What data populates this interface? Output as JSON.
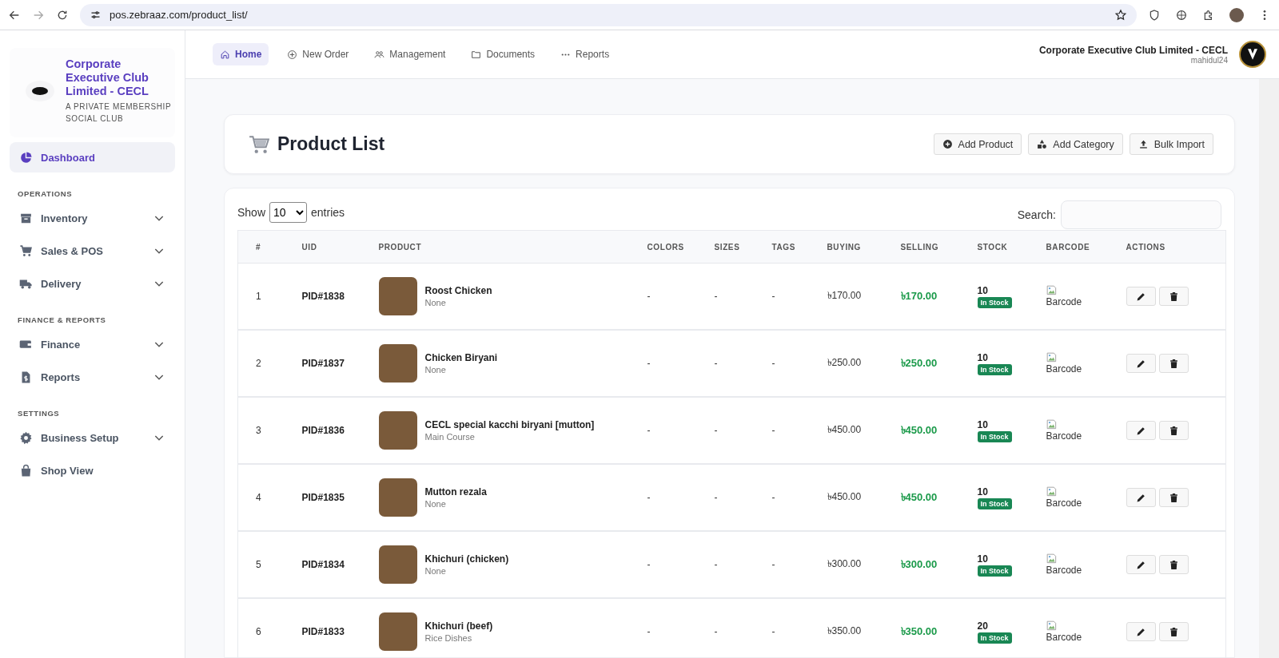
{
  "browser": {
    "url": "pos.zebraaz.com/product_list/"
  },
  "sidebar": {
    "brand": {
      "name": "Corporate Executive Club Limited - CECL",
      "tagline": "A PRIVATE MEMBERSHIP SOCIAL CLUB"
    },
    "groups": [
      {
        "items": [
          {
            "label": "Dashboard",
            "selected": true,
            "expandable": false
          }
        ]
      },
      {
        "heading": "OPERATIONS",
        "items": [
          {
            "label": "Inventory",
            "selected": false,
            "expandable": true
          },
          {
            "label": "Sales & POS",
            "selected": false,
            "expandable": true
          },
          {
            "label": "Delivery",
            "selected": false,
            "expandable": true
          }
        ]
      },
      {
        "heading": "FINANCE & REPORTS",
        "items": [
          {
            "label": "Finance",
            "selected": false,
            "expandable": true
          },
          {
            "label": "Reports",
            "selected": false,
            "expandable": true
          }
        ]
      },
      {
        "heading": "SETTINGS",
        "items": [
          {
            "label": "Business Setup",
            "selected": false,
            "expandable": true
          },
          {
            "label": "Shop View",
            "selected": false,
            "expandable": false
          }
        ]
      }
    ]
  },
  "topnav": {
    "tabs": [
      {
        "label": "Home",
        "selected": true
      },
      {
        "label": "New Order",
        "selected": false
      },
      {
        "label": "Management",
        "selected": false
      },
      {
        "label": "Documents",
        "selected": false
      },
      {
        "label": "Reports",
        "selected": false
      }
    ],
    "user": {
      "organization": "Corporate Executive Club Limited - CECL",
      "username": "mahidul24"
    }
  },
  "page": {
    "title": "Product List",
    "buttons": [
      "Add Product",
      "Add Category",
      "Bulk Import"
    ]
  },
  "table": {
    "show_label": "Show",
    "page_size": "10",
    "entries_label": "entries",
    "search_label": "Search:",
    "columns": [
      "#",
      "UID",
      "PRODUCT",
      "COLORS",
      "SIZES",
      "TAGS",
      "BUYING",
      "SELLING",
      "STOCK",
      "BARCODE",
      "ACTIONS"
    ],
    "rows": [
      {
        "index": "1",
        "uid": "PID#1838",
        "product": "Roost Chicken",
        "category": "None",
        "colors": "-",
        "sizes": "-",
        "tags": "-",
        "buying": "৳170.00",
        "selling": "৳170.00",
        "stock": "10",
        "stock_status": "In Stock",
        "barcode": "Barcode"
      },
      {
        "index": "2",
        "uid": "PID#1837",
        "product": "Chicken Biryani",
        "category": "None",
        "colors": "-",
        "sizes": "-",
        "tags": "-",
        "buying": "৳250.00",
        "selling": "৳250.00",
        "stock": "10",
        "stock_status": "In Stock",
        "barcode": "Barcode"
      },
      {
        "index": "3",
        "uid": "PID#1836",
        "product": "CECL special kacchi biryani [mutton]",
        "category": "Main Course",
        "colors": "-",
        "sizes": "-",
        "tags": "-",
        "buying": "৳450.00",
        "selling": "৳450.00",
        "stock": "10",
        "stock_status": "In Stock",
        "barcode": "Barcode"
      },
      {
        "index": "4",
        "uid": "PID#1835",
        "product": "Mutton rezala",
        "category": "None",
        "colors": "-",
        "sizes": "-",
        "tags": "-",
        "buying": "৳450.00",
        "selling": "৳450.00",
        "stock": "10",
        "stock_status": "In Stock",
        "barcode": "Barcode"
      },
      {
        "index": "5",
        "uid": "PID#1834",
        "product": "Khichuri (chicken)",
        "category": "None",
        "colors": "-",
        "sizes": "-",
        "tags": "-",
        "buying": "৳300.00",
        "selling": "৳300.00",
        "stock": "10",
        "stock_status": "In Stock",
        "barcode": "Barcode"
      },
      {
        "index": "6",
        "uid": "PID#1833",
        "product": "Khichuri (beef)",
        "category": "Rice Dishes",
        "colors": "-",
        "sizes": "-",
        "tags": "-",
        "buying": "৳350.00",
        "selling": "৳350.00",
        "stock": "20",
        "stock_status": "In Stock",
        "barcode": "Barcode"
      }
    ]
  }
}
